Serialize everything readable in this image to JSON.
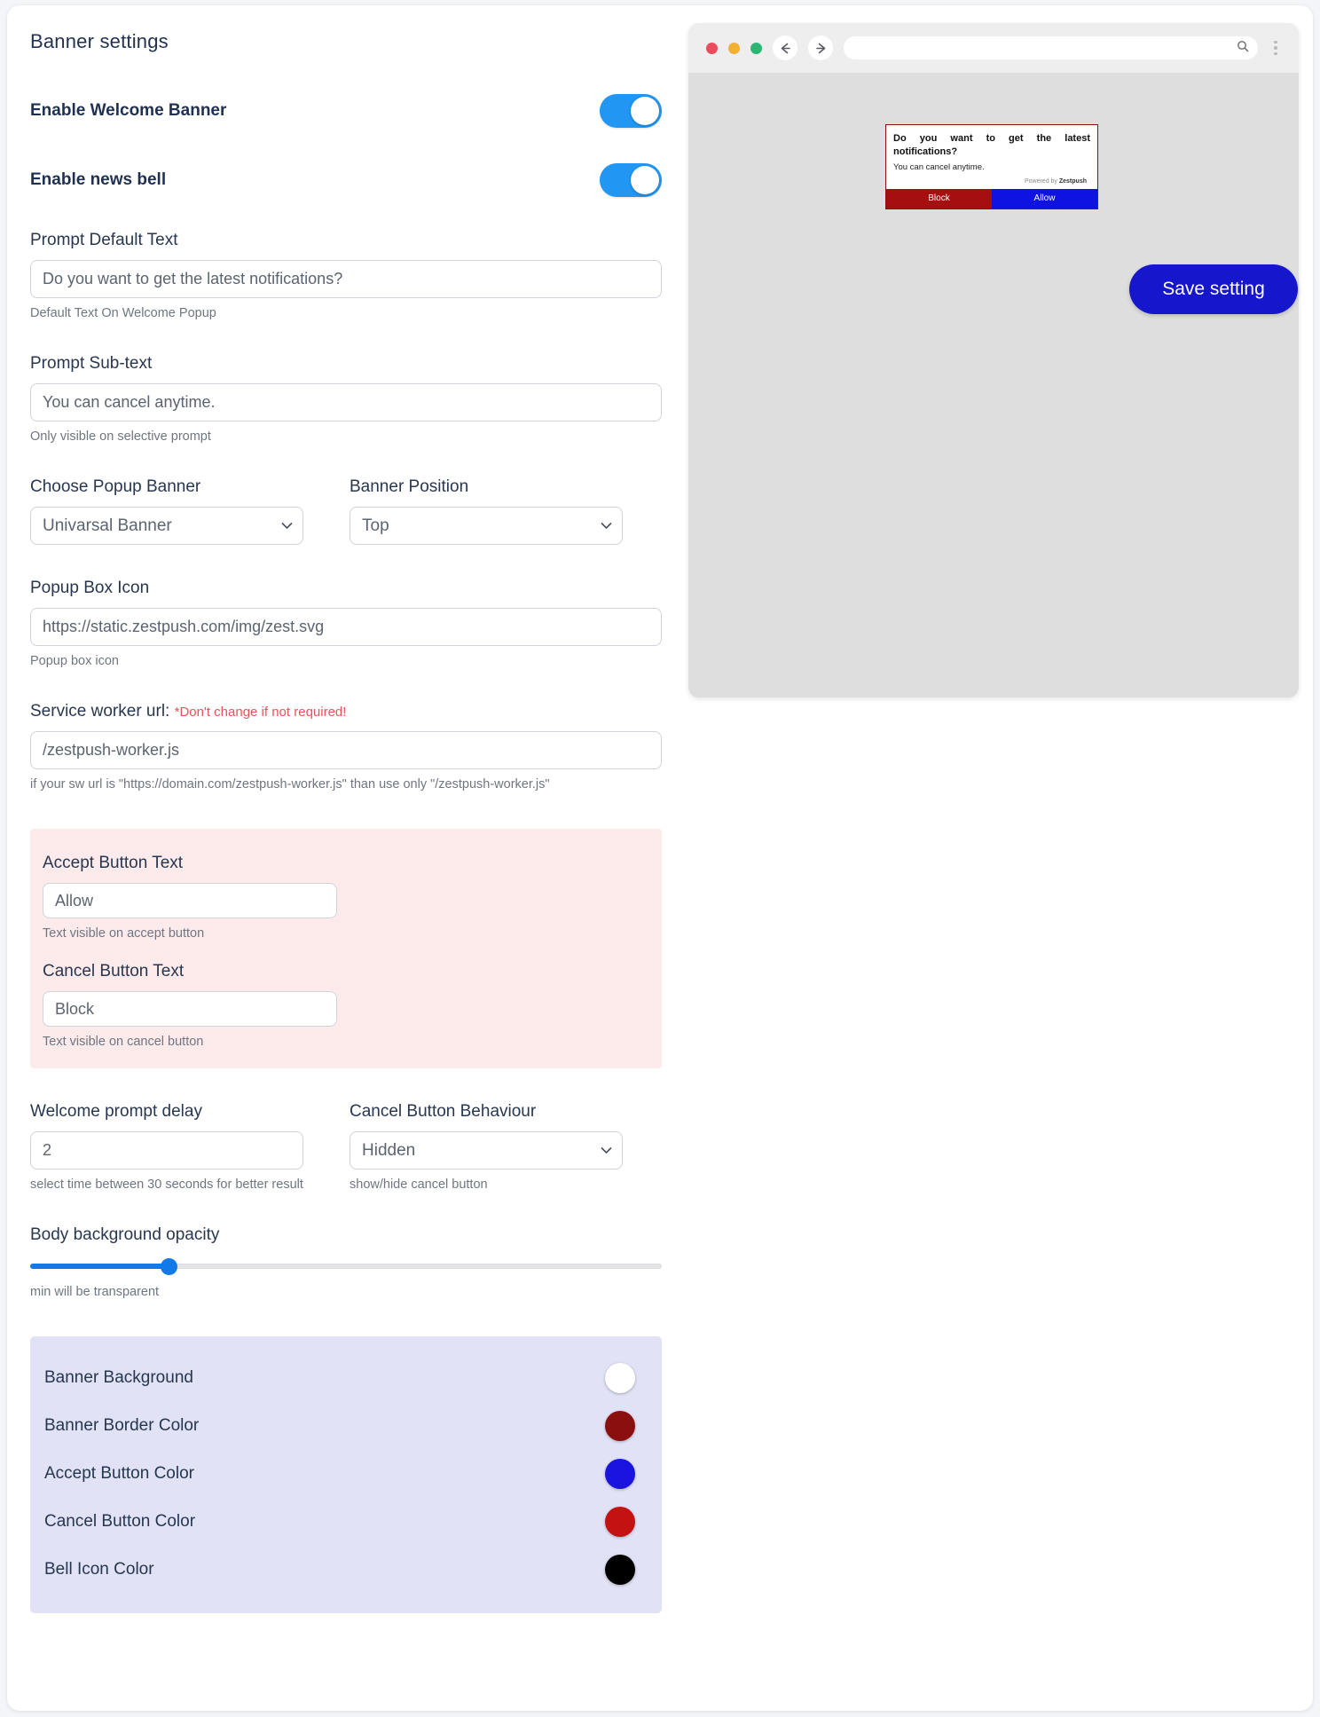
{
  "page": {
    "title": "Banner settings"
  },
  "toggles": [
    {
      "label": "Enable Welcome Banner",
      "state": "on"
    },
    {
      "label": "Enable news bell",
      "state": "on"
    }
  ],
  "fields": {
    "prompt_default": {
      "label": "Prompt Default Text",
      "value": "Do you want to get the latest notifications?",
      "helper": "Default Text On Welcome Popup"
    },
    "prompt_subtext": {
      "label": "Prompt Sub-text",
      "value": "You can cancel anytime.",
      "helper": "Only visible on selective prompt"
    },
    "choose_banner": {
      "label": "Choose Popup Banner",
      "value": "Univarsal Banner"
    },
    "banner_position": {
      "label": "Banner Position",
      "value": "Top"
    },
    "popup_box_icon": {
      "label": "Popup Box Icon",
      "value": "https://static.zestpush.com/img/zest.svg",
      "helper": "Popup box icon"
    },
    "service_worker": {
      "label": "Service worker url:",
      "warning": "*Don't change if not required!",
      "value": "/zestpush-worker.js",
      "helper": "if your sw url is \"https://domain.com/zestpush-worker.js\" than use only \"/zestpush-worker.js\""
    },
    "accept_button_text": {
      "label": "Accept Button Text",
      "value": "Allow",
      "helper": "Text visible on accept button"
    },
    "cancel_button_text": {
      "label": "Cancel Button Text",
      "value": "Block",
      "helper": "Text visible on cancel button"
    },
    "welcome_delay": {
      "label": "Welcome prompt delay",
      "value": "2",
      "helper": "select time between 30 seconds for better result"
    },
    "cancel_behaviour": {
      "label": "Cancel Button Behaviour",
      "value": "Hidden",
      "helper": "show/hide cancel button"
    },
    "opacity": {
      "label": "Body background opacity",
      "helper": "min will be transparent",
      "percent": 22
    }
  },
  "colors": [
    {
      "name": "Banner Background",
      "hex": "#ffffff"
    },
    {
      "name": "Banner Border Color",
      "hex": "#8b0f0f"
    },
    {
      "name": "Accept Button Color",
      "hex": "#1a14e0"
    },
    {
      "name": "Cancel Button Color",
      "hex": "#c41111"
    },
    {
      "name": "Bell Icon Color",
      "hex": "#000000"
    }
  ],
  "preview": {
    "address_value": "",
    "address_placeholder": "",
    "notification": {
      "title": "Do you want to get the latest notifications?",
      "subtext": "You can cancel anytime.",
      "powered_prefix": "Powered by ",
      "powered_brand": "Zestpush",
      "cancel_label": "Block",
      "accept_label": "Allow"
    },
    "save_label": "Save setting"
  }
}
